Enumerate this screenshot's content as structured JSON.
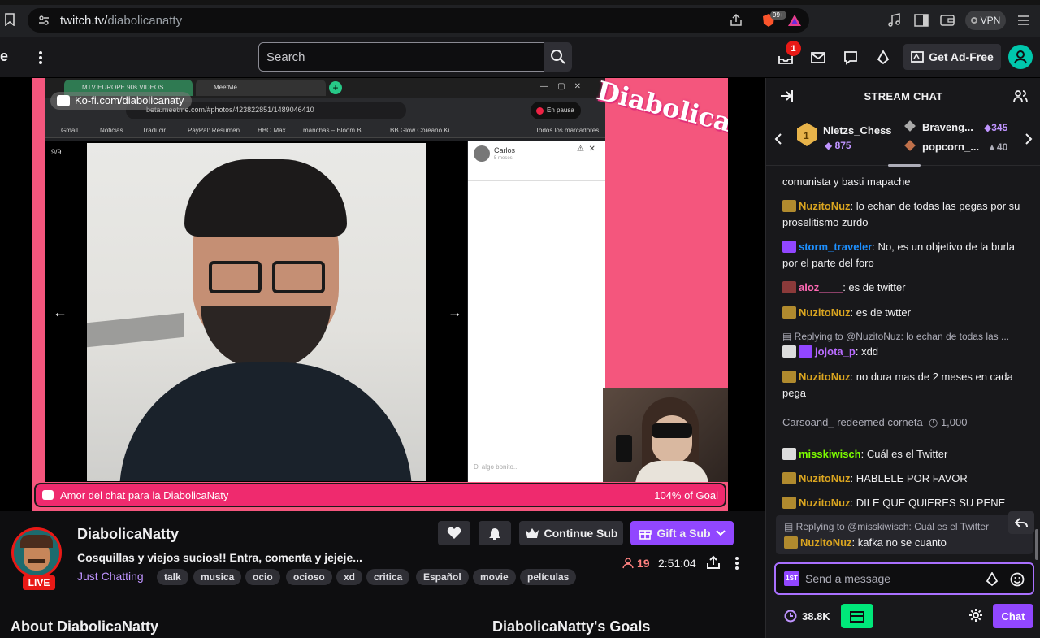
{
  "browser": {
    "url_host": "twitch.tv/",
    "url_path": "diabolicanatty",
    "vpn_label": "VPN",
    "brave_badge": "99+"
  },
  "topnav": {
    "search_placeholder": "Search",
    "notification_count": "1",
    "ad_free_label": "Get Ad-Free"
  },
  "stream_overlay": {
    "inner_tabs": [
      "MTV EUROPE 90s VIDEOS",
      "MeetMe"
    ],
    "inner_url": "beta.meetme.com/#photos/423822851/1489046410",
    "pause_label": "En pausa",
    "bookmarks": [
      "Gmail",
      "Noticias",
      "Traducir",
      "PayPal: Resumen",
      "HBO Max",
      "manchas – Bloom B...",
      "BB Glow Coreano Ki...",
      "Todos los marcadores"
    ],
    "photo_counter": "9/9",
    "chat_contact_name": "Carlos",
    "chat_contact_sub": "5 meses",
    "chat_input_placeholder": "Di algo bonito...",
    "kofi_text": "Ko-fi.com/diabolicanaty",
    "logo_text": "Diabolica",
    "goal_text": "Amor del chat para la DiabolicaNaty",
    "goal_percent": "104% of Goal"
  },
  "channel": {
    "name": "DiabolicaNatty",
    "live_label": "LIVE",
    "title": "Cosquillas y viejos sucios!! Entra, comenta y jejeje...",
    "category": "Just Chatting",
    "tags": [
      "talk",
      "musica",
      "ocio",
      "ocioso",
      "xd",
      "critica",
      "Español",
      "movie",
      "películas"
    ],
    "continue_sub_label": "Continue Sub",
    "gift_sub_label": "Gift a Sub",
    "viewers": "19",
    "uptime": "2:51:04",
    "about_heading": "About DiabolicaNatty",
    "goals_heading": "DiabolicaNatty's Goals"
  },
  "chat": {
    "title": "STREAM CHAT",
    "leaderboard": [
      {
        "name": "Nietzs_Chess",
        "value": "875"
      },
      {
        "name": "Braveng...",
        "value": "345"
      },
      {
        "name": "popcorn_...",
        "value": "40"
      }
    ],
    "messages": [
      {
        "user": "",
        "text": "comunista y basti mapache"
      },
      {
        "user": "NuzitoNuz",
        "text": ": lo echan de todas las pegas por su proselitismo zurdo"
      },
      {
        "user": "storm_traveler",
        "text": ": No, es un objetivo de la burla por el parte del foro"
      },
      {
        "user": "aloz____",
        "text": ": es de twitter"
      },
      {
        "user": "NuzitoNuz",
        "text": ": es de twtter"
      },
      {
        "reply": "Replying to @NuzitoNuz: lo echan de todas las ..."
      },
      {
        "user": "jojota_p",
        "text": ": xdd"
      },
      {
        "user": "NuzitoNuz",
        "text": ": no dura mas de 2 meses en cada pega"
      },
      {
        "system": "Carsoand_ redeemed corneta",
        "cost": "1,000"
      },
      {
        "user": "misskiwisch",
        "text": ": Cuál es el Twitter"
      },
      {
        "user": "NuzitoNuz",
        "text": ": HABLELE POR FAVOR"
      },
      {
        "user": "NuzitoNuz",
        "text": ": DILE QUE QUIERES SU PENE"
      }
    ],
    "pinned_reply": {
      "reply": "Replying to @misskiwisch: Cuál es el Twitter",
      "user": "NuzitoNuz",
      "text": ": kafka no se cuanto"
    },
    "input_placeholder": "Send a message",
    "points": "38.8K",
    "send_label": "Chat"
  },
  "colors": {
    "accent": "#9147ff",
    "pink_frame": "#f4567d",
    "live_red": "#e91916"
  }
}
